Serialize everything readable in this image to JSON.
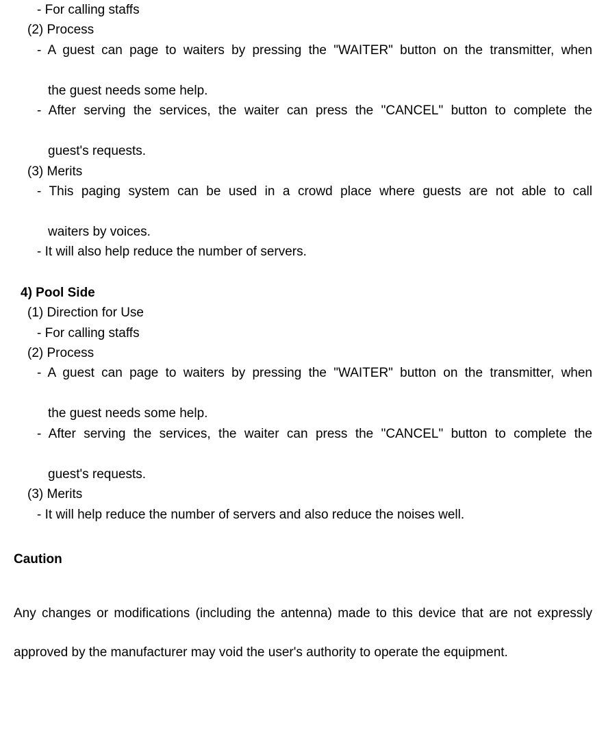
{
  "section3": {
    "sub1_item1": "- For calling staffs",
    "sub2_label": "(2) Process",
    "sub2_item1_a": "- A guest can page to waiters by pressing the \"WAITER\" button on the transmitter, when",
    "sub2_item1_b": "the guest needs some help.",
    "sub2_item2_a": "- After serving the services, the waiter can press the \"CANCEL\" button to complete the",
    "sub2_item2_b": "guest's requests.",
    "sub3_label": "(3) Merits",
    "sub3_item1_a": "- This paging system can be used in a crowd place where guests are not able to call",
    "sub3_item1_b": "waiters by voices.",
    "sub3_item2": "- It will also help reduce the number of servers."
  },
  "section4": {
    "title": "4) Pool Side",
    "sub1_label": "(1) Direction for Use",
    "sub1_item1": "- For calling staffs",
    "sub2_label": "(2) Process",
    "sub2_item1_a": "- A guest can page to waiters by pressing the \"WAITER\" button on the transmitter, when",
    "sub2_item1_b": "the guest needs some help.",
    "sub2_item2_a": "- After serving the services, the waiter can press the \"CANCEL\" button to complete the",
    "sub2_item2_b": "guest's requests.",
    "sub3_label": "(3) Merits",
    "sub3_item1": "- It will help reduce the number of servers and also reduce the noises well."
  },
  "caution": {
    "title": "Caution",
    "body": "Any changes or modifications (including the antenna) made to this device that are not expressly approved by the manufacturer may void the user's authority to operate the equipment."
  }
}
